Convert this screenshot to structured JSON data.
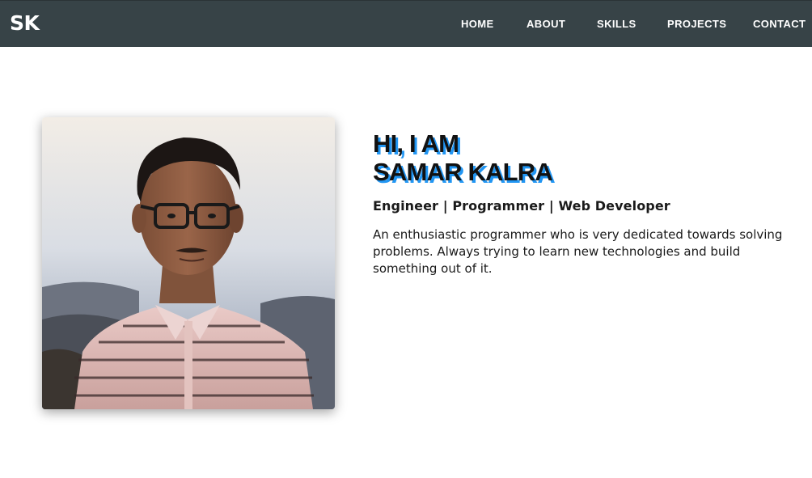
{
  "header": {
    "logo": "SK",
    "nav": {
      "home": "HOME",
      "about": "ABOUT",
      "skills": "SKILLS",
      "projects": "PROJECTS",
      "contact": "CONTACT"
    },
    "background_color": "#374347"
  },
  "hero": {
    "greeting_line1": "HI, I AM",
    "greeting_line2": "SAMAR KALRA",
    "subtitle": "Engineer | Programmer | Web Developer",
    "description": "An enthusiastic programmer who is very dedicated towards solving problems. Always trying to learn new technologies and build something out of it.",
    "accent_color": "#2196f3"
  }
}
